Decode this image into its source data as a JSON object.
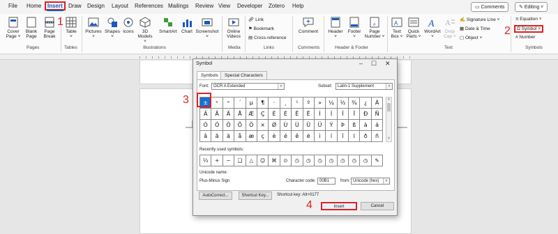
{
  "tabs": [
    "File",
    "Home",
    "Insert",
    "Draw",
    "Design",
    "Layout",
    "References",
    "Mailings",
    "Review",
    "View",
    "Developer",
    "Zotero",
    "Help"
  ],
  "top_right": {
    "comments": "Comments",
    "editing": "Editing"
  },
  "ribbon": {
    "pages": {
      "cover": "Cover\nPage ˅",
      "blank": "Blank\nPage",
      "break": "Page\nBreak",
      "label": "Pages"
    },
    "tables": {
      "table": "Table\n˅",
      "label": "Tables"
    },
    "illustrations": {
      "pictures": "Pictures\n˅",
      "shapes": "Shapes\n˅",
      "icons": "Icons",
      "models": "3D\nModels ˅",
      "smartart": "SmartArt",
      "chart": "Chart",
      "screenshot": "Screenshot\n˅",
      "label": "Illustrations"
    },
    "media": {
      "online": "Online\nVideos",
      "label": "Media"
    },
    "links": {
      "link": "Link",
      "bookmark": "Bookmark",
      "crossref": "Cross-reference",
      "label": "Links"
    },
    "comments": {
      "comment": "Comment",
      "label": "Comments"
    },
    "header_footer": {
      "header": "Header\n˅",
      "footer": "Footer\n˅",
      "page_number": "Page\nNumber ˅",
      "label": "Header & Footer"
    },
    "text": {
      "textbox": "Text\nBox ˅",
      "quickparts": "Quick\nParts ˅",
      "wordart": "WordArt\n˅",
      "dropcap": "Drop\nCap ˅",
      "label": "Text"
    },
    "text_small": {
      "signature": "Signature Line  ˅",
      "datetime": "Date & Time",
      "object": "Object  ˅"
    },
    "symbols": {
      "equation": "Equation  ˅",
      "symbol": "Symbol",
      "number": "Number",
      "label": "Symbols"
    }
  },
  "steps": [
    "1",
    "2",
    "3",
    "4"
  ],
  "dialog": {
    "title": "Symbol",
    "tabs": [
      "Symbols",
      "Special Characters"
    ],
    "font_label": "Font:",
    "font_value": "OCR A Extended",
    "subset_label": "Subset:",
    "subset_value": "Latin-1 Supplement",
    "grid": [
      [
        "±",
        "ᵉ",
        "ᵊ",
        "ˊ",
        "µ",
        "¶",
        "·",
        "¸",
        "¹",
        "º",
        "»",
        "¼",
        "½",
        "¾",
        "¿",
        "À",
        "Á"
      ],
      [
        "Â",
        "Ã",
        "Ä",
        "Å",
        "Æ",
        "Ç",
        "È",
        "É",
        "Ê",
        "Ë",
        "Ì",
        "Í",
        "Î",
        "Ï",
        "Ð",
        "Ñ"
      ],
      [
        "Ò",
        "Ó",
        "Ô",
        "Õ",
        "Ö",
        "×",
        "Ø",
        "Ù",
        "Ú",
        "Û",
        "Ü",
        "Ý",
        "Þ",
        "ß",
        "à",
        "á"
      ],
      [
        "â",
        "ã",
        "ä",
        "å",
        "æ",
        "ç",
        "è",
        "é",
        "ê",
        "ë",
        "ì",
        "í",
        "î",
        "ï",
        "ð",
        "ñ"
      ]
    ],
    "recent_label": "Recently used symbols:",
    "recent": [
      "⅓",
      "+",
      "−",
      "❑",
      "△",
      "☺",
      "⌘",
      "⊙",
      "◷",
      "◷",
      "◷",
      "◷",
      "◷",
      "◷",
      "◷",
      "✎"
    ],
    "unicode_name_label": "Unicode name:",
    "unicode_name": "Plus-Minus Sign",
    "char_code_label": "Character code:",
    "char_code": "00B1",
    "from_label": "from:",
    "from_value": "Unicode (hex)",
    "autocorrect": "AutoCorrect...",
    "shortcut_key": "Shortcut Key...",
    "shortcut_text": "Shortcut key: Alt+0177",
    "insert": "Insert",
    "cancel": "Cancel"
  },
  "colors": {
    "accent": "#185abd",
    "annotation": "#e02020",
    "selected": "#1a6fce"
  }
}
